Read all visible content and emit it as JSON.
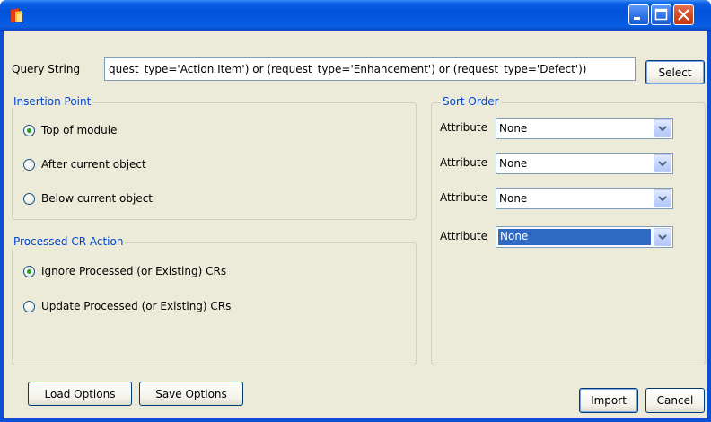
{
  "query": {
    "label": "Query String",
    "value": "quest_type='Action Item') or (request_type='Enhancement') or (request_type='Defect'))",
    "select_label": "Select"
  },
  "insertion": {
    "title": "Insertion Point",
    "options": [
      {
        "label": "Top of module",
        "checked": true
      },
      {
        "label": "After current object",
        "checked": false
      },
      {
        "label": "Below current object",
        "checked": false
      }
    ]
  },
  "processed": {
    "title": "Processed CR Action",
    "options": [
      {
        "label": "Ignore Processed (or Existing) CRs",
        "checked": true
      },
      {
        "label": "Update Processed (or Existing) CRs",
        "checked": false
      }
    ]
  },
  "sort": {
    "title": "Sort Order",
    "rows": [
      {
        "label": "Attribute",
        "value": "None"
      },
      {
        "label": "Attribute",
        "value": "None"
      },
      {
        "label": "Attribute",
        "value": "None"
      },
      {
        "label": "Attribute",
        "value": "None"
      }
    ]
  },
  "buttons": {
    "load": "Load Options",
    "save": "Save Options",
    "import": "Import",
    "cancel": "Cancel"
  },
  "icons": [
    "app-icon",
    "minimize-icon",
    "maximize-icon",
    "close-icon",
    "radio-icon",
    "chevron-down-icon"
  ],
  "colors": {
    "titlebar": "#0052d9",
    "group_title": "#0046d5",
    "selection": "#316ac5",
    "radio_dot": "#21a121",
    "dialog_bg": "#ecead8"
  }
}
